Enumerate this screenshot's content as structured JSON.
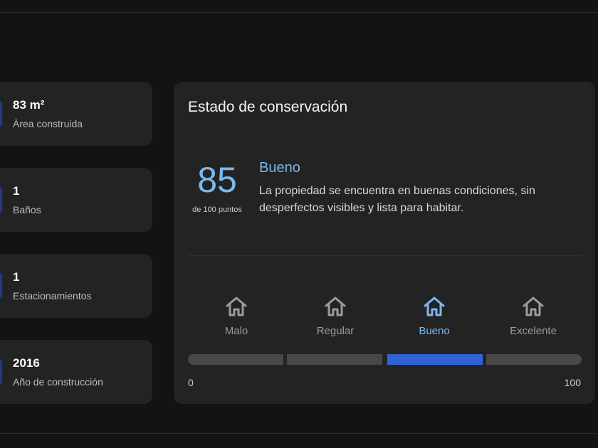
{
  "stats": [
    {
      "value": "83 m²",
      "label": "Àrea construida"
    },
    {
      "value": "1",
      "label": "Baños"
    },
    {
      "value": "1",
      "label": "Estacionamientos"
    },
    {
      "value": "2016",
      "label": "Año de construcción"
    }
  ],
  "conservation": {
    "title": "Estado de conservación",
    "score": "85",
    "score_caption": "de 100 puntos",
    "rating": "Bueno",
    "description": "La propiedad se encuentra en buenas condiciones, sin desperfectos visibles y lista para habitar.",
    "levels": [
      {
        "label": "Malo",
        "icon": "house-icon",
        "active": false
      },
      {
        "label": "Regular",
        "icon": "house-icon",
        "active": false
      },
      {
        "label": "Bueno",
        "icon": "house-icon",
        "active": true
      },
      {
        "label": "Excelente",
        "icon": "house-icon",
        "active": false
      }
    ],
    "scale_min": "0",
    "scale_max": "100"
  },
  "colors": {
    "background": "#131313",
    "card": "#232323",
    "accent_text": "#7db7f0",
    "active_segment": "#2f63d6",
    "inactive_segment": "#484848"
  }
}
